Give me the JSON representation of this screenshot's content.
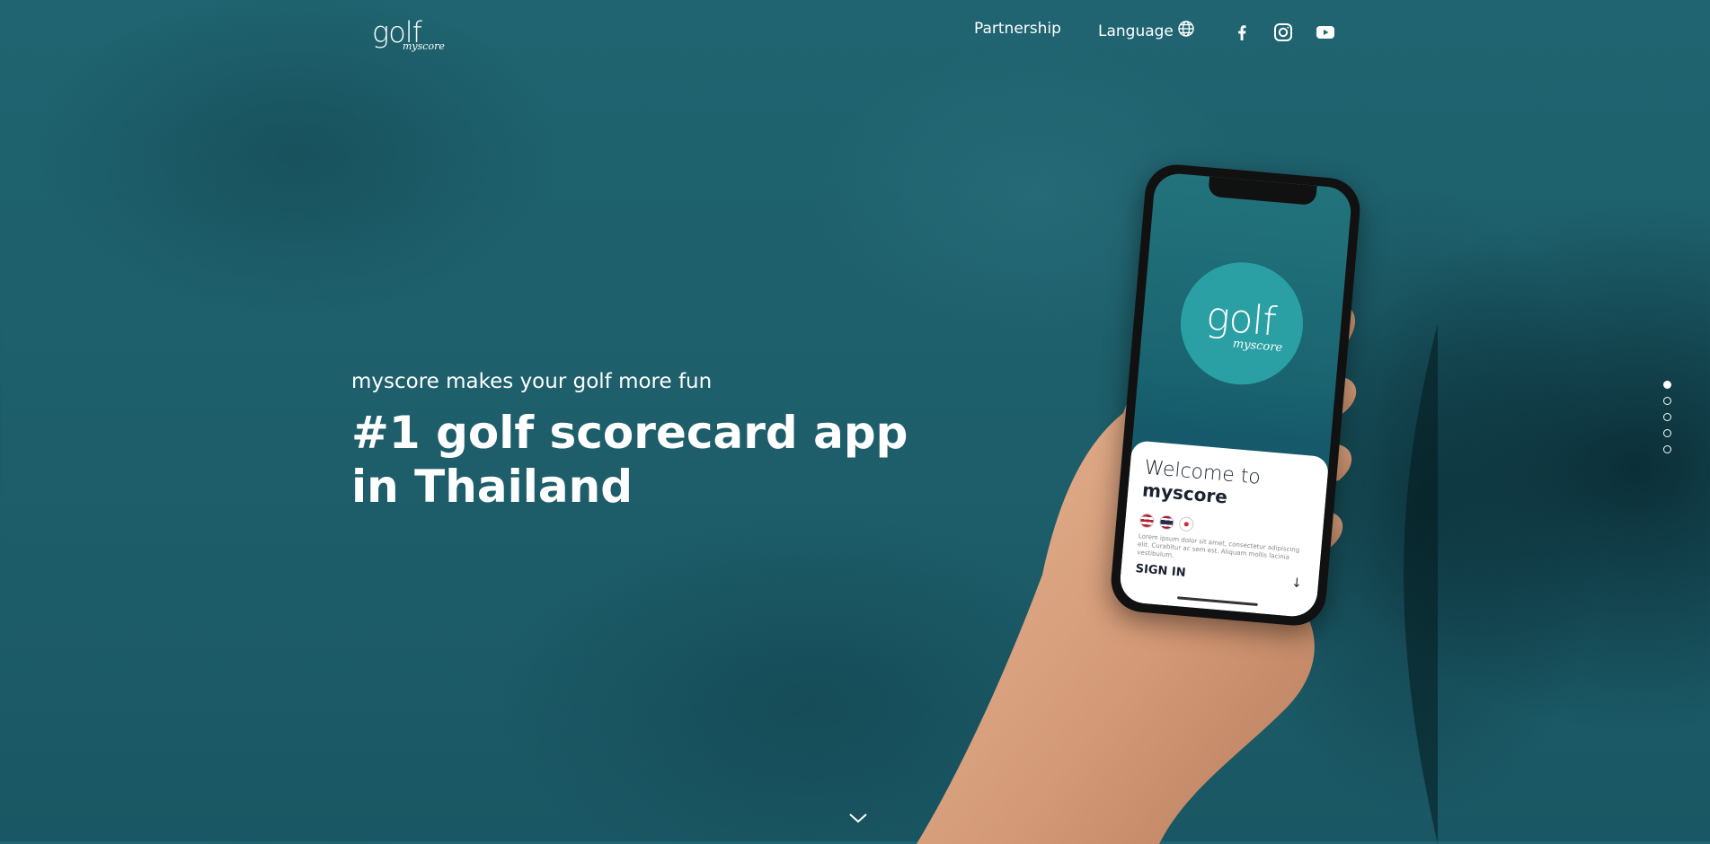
{
  "header": {
    "logo": {
      "word": "golf",
      "sub": "myscore"
    },
    "nav": {
      "partnership": "Partnership",
      "language": "Language"
    },
    "social": [
      "facebook-icon",
      "instagram-icon",
      "youtube-icon"
    ]
  },
  "hero": {
    "subtitle": "myscore makes your golf more fun",
    "title_line1": "#1 golf scorecard app",
    "title_line2": "in Thailand"
  },
  "phone": {
    "logo_word": "golf",
    "logo_sub": "myscore",
    "welcome": "Welcome to",
    "brand": "myscore",
    "lorem": "Lorem ipsum dolor sit amet, consectetur adipiscing elit. Curabitur ac sem est. Aliquam mollis lacinia vestibulum.",
    "signin": "SIGN IN"
  },
  "pagination": {
    "total": 5,
    "active": 1
  },
  "colors": {
    "background": "#1f6470",
    "accent": "#2aa0a4",
    "text": "#ffffff"
  }
}
